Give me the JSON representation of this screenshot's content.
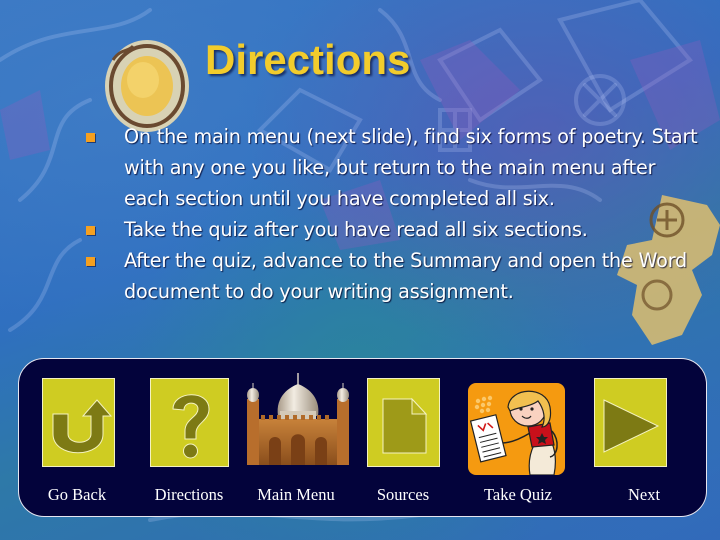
{
  "slide": {
    "title": "Directions",
    "colors": {
      "title": "#f2cc2c",
      "bullet_marker": "#f5a020",
      "body_text": "#ffffff",
      "nav_panel": "#03033b",
      "nav_tile": "#cfcc22",
      "nav_glyph": "#7d7a14",
      "quiz_tile": "#f59a10"
    },
    "bullets": [
      "On the main menu (next slide), find six forms of poetry. Start with any one you like, but return to the main menu after each section until you have completed all six.",
      "Take the quiz after you have read all six sections.",
      "After the quiz, advance to the Summary and open the Word document to do your writing assignment."
    ]
  },
  "nav": {
    "items": [
      {
        "label": "Go Back",
        "icon": "u-turn-arrow-icon"
      },
      {
        "label": "Directions",
        "icon": "question-mark-icon"
      },
      {
        "label": "Main Menu",
        "icon": "mosque-icon"
      },
      {
        "label": "Sources",
        "icon": "document-icon"
      },
      {
        "label": "Take Quiz",
        "icon": "student-with-test-icon"
      },
      {
        "label": "Next",
        "icon": "play-triangle-icon"
      }
    ]
  }
}
